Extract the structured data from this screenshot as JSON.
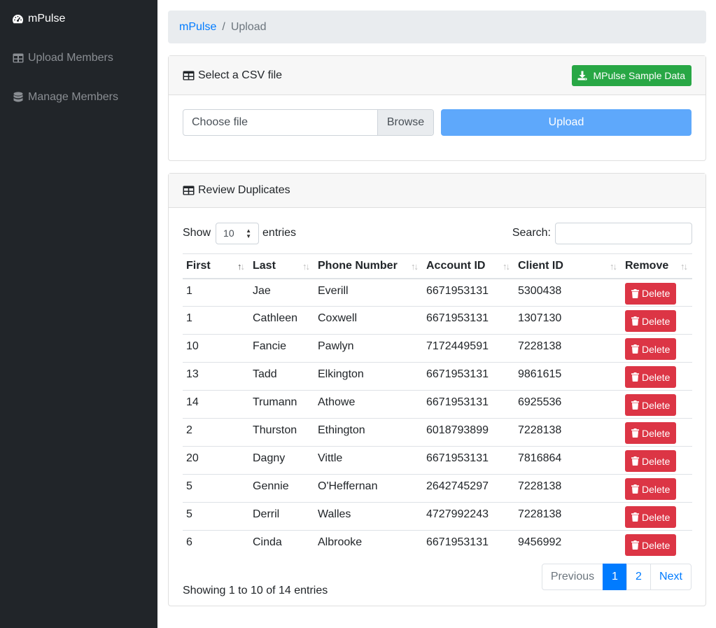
{
  "sidebar": {
    "brand": "mPulse",
    "items": [
      {
        "label": "Upload Members",
        "icon": "table-icon"
      },
      {
        "label": "Manage Members",
        "icon": "database-icon"
      }
    ]
  },
  "breadcrumb": {
    "home": "mPulse",
    "separator": "/",
    "current": "Upload"
  },
  "upload_card": {
    "title": "Select a CSV file",
    "sample_button": "MPulse Sample Data",
    "file_placeholder": "Choose file",
    "browse_label": "Browse",
    "upload_button": "Upload"
  },
  "duplicates_card": {
    "title": "Review Duplicates",
    "show_label": "Show",
    "entries_label": "entries",
    "page_length": "10",
    "search_label": "Search:",
    "search_value": "",
    "columns": [
      "First",
      "Last",
      "Phone Number",
      "Account ID",
      "Client ID",
      "Remove"
    ],
    "delete_label": "Delete",
    "rows": [
      [
        "1",
        "Jae",
        "Everill",
        "6671953131",
        "5300438"
      ],
      [
        "1",
        "Cathleen",
        "Coxwell",
        "6671953131",
        "1307130"
      ],
      [
        "10",
        "Fancie",
        "Pawlyn",
        "7172449591",
        "7228138"
      ],
      [
        "13",
        "Tadd",
        "Elkington",
        "6671953131",
        "9861615"
      ],
      [
        "14",
        "Trumann",
        "Athowe",
        "6671953131",
        "6925536"
      ],
      [
        "2",
        "Thurston",
        "Ethington",
        "6018793899",
        "7228138"
      ],
      [
        "20",
        "Dagny",
        "Vittle",
        "6671953131",
        "7816864"
      ],
      [
        "5",
        "Gennie",
        "O'Heffernan",
        "2642745297",
        "7228138"
      ],
      [
        "5",
        "Derril",
        "Walles",
        "4727992243",
        "7228138"
      ],
      [
        "6",
        "Cinda",
        "Albrooke",
        "6671953131",
        "9456992"
      ]
    ],
    "info": "Showing 1 to 10 of 14 entries",
    "pagination": {
      "previous": "Previous",
      "pages": [
        "1",
        "2"
      ],
      "next": "Next",
      "active_page": "1"
    }
  },
  "colors": {
    "sidebar_bg": "#212529",
    "link": "#007bff",
    "success": "#28a745",
    "danger": "#dc3545",
    "upload_disabled": "#5ea8fb"
  }
}
